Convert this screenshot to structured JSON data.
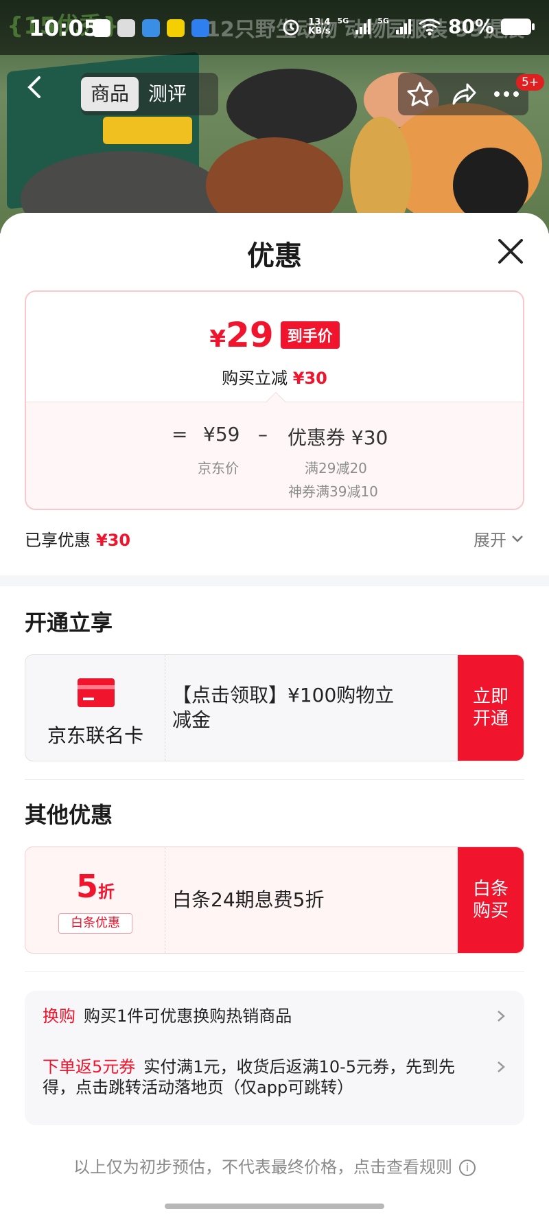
{
  "status_bar": {
    "time": "10:05",
    "net_speed_top": "13.4",
    "net_speed_bottom": "KB/s",
    "sim1": "5G",
    "sim2": "5G",
    "battery": "80%"
  },
  "background": {
    "ghost_left": "{15优秀}",
    "ghost_title": "12只野生动物 动物园服装 99提展"
  },
  "product_nav": {
    "tabs": [
      {
        "label": "商品",
        "active": true
      },
      {
        "label": "测评",
        "active": false
      }
    ],
    "more_badge": "5+"
  },
  "sheet": {
    "title": "优惠",
    "price_card": {
      "currency": "¥",
      "final_price": "29",
      "price_tag": "到手价",
      "save_prefix": "购买立减",
      "save_amount": "¥30",
      "eq": "=",
      "base_price": "¥59",
      "minus": "–",
      "coupon_label": "优惠券 ¥30",
      "base_caption": "京东价",
      "coupon_rule1": "满29减20",
      "coupon_rule2": "神券满39减10"
    },
    "enjoyed_label": "已享优惠",
    "enjoyed_amount": "¥30",
    "expand_label": "展开",
    "open_section": {
      "title": "开通立享",
      "card_label": "京东联名卡",
      "offer_text": "【点击领取】¥100购物立减金",
      "cta": "立即开通"
    },
    "other_section": {
      "title": "其他优惠",
      "discount_num": "5",
      "discount_unit": "折",
      "discount_tag": "白条优惠",
      "offer_text": "白条24期息费5折",
      "cta": "白条购买"
    },
    "extras": [
      {
        "tag": "换购",
        "text": "购买1件可优惠换购热销商品"
      },
      {
        "tag": "下单返5元券",
        "text": "实付满1元，收货后返满10-5元券，先到先得，点击跳转活动落地页（仅app可跳转）"
      }
    ],
    "footer_note": "以上仅为初步预估，不代表最终价格，点击查看规则",
    "footer_info": "i"
  },
  "colors": {
    "accent": "#f0152c",
    "card_border": "#f8c8cc",
    "muted": "#8a8a8a"
  }
}
